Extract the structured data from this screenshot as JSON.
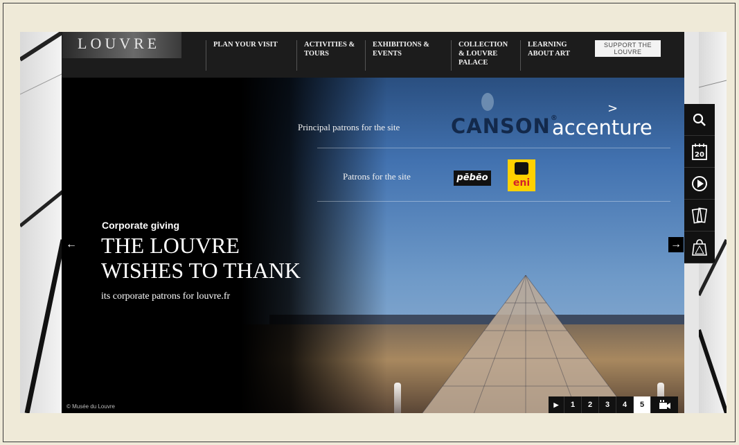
{
  "logo": {
    "text": "LOUVRE"
  },
  "nav": {
    "items": [
      {
        "label": "PLAN YOUR VISIT"
      },
      {
        "label": "ACTIVITIES & TOURS"
      },
      {
        "label": "EXHIBITIONS & EVENTS"
      },
      {
        "label": "COLLECTION & LOUVRE PALACE"
      },
      {
        "label": "LEARNING ABOUT ART"
      }
    ],
    "support": "SUPPORT THE LOUVRE"
  },
  "hero": {
    "principal_patrons_label": "Principal patrons for the site",
    "patrons_label": "Patrons for the site",
    "logos": {
      "canson": "CANSON",
      "accenture": "accenture",
      "pebeo": "pēbēo",
      "eni": "eni"
    },
    "kicker": "Corporate giving",
    "headline_line1": "THE LOUVRE",
    "headline_line2": "WISHES TO THANK",
    "subline": "its corporate patrons for louvre.fr",
    "copyright": "© Musée du Louvre",
    "prev_arrow": "←",
    "next_arrow": "→"
  },
  "toolbar": {
    "icons": [
      "search-icon",
      "calendar-icon",
      "play-circle-icon",
      "tickets-icon",
      "shopping-bag-icon"
    ],
    "calendar_day": "20"
  },
  "pager": {
    "play": "▶",
    "pages": [
      "1",
      "2",
      "3",
      "4",
      "5"
    ],
    "active_page": "5"
  }
}
